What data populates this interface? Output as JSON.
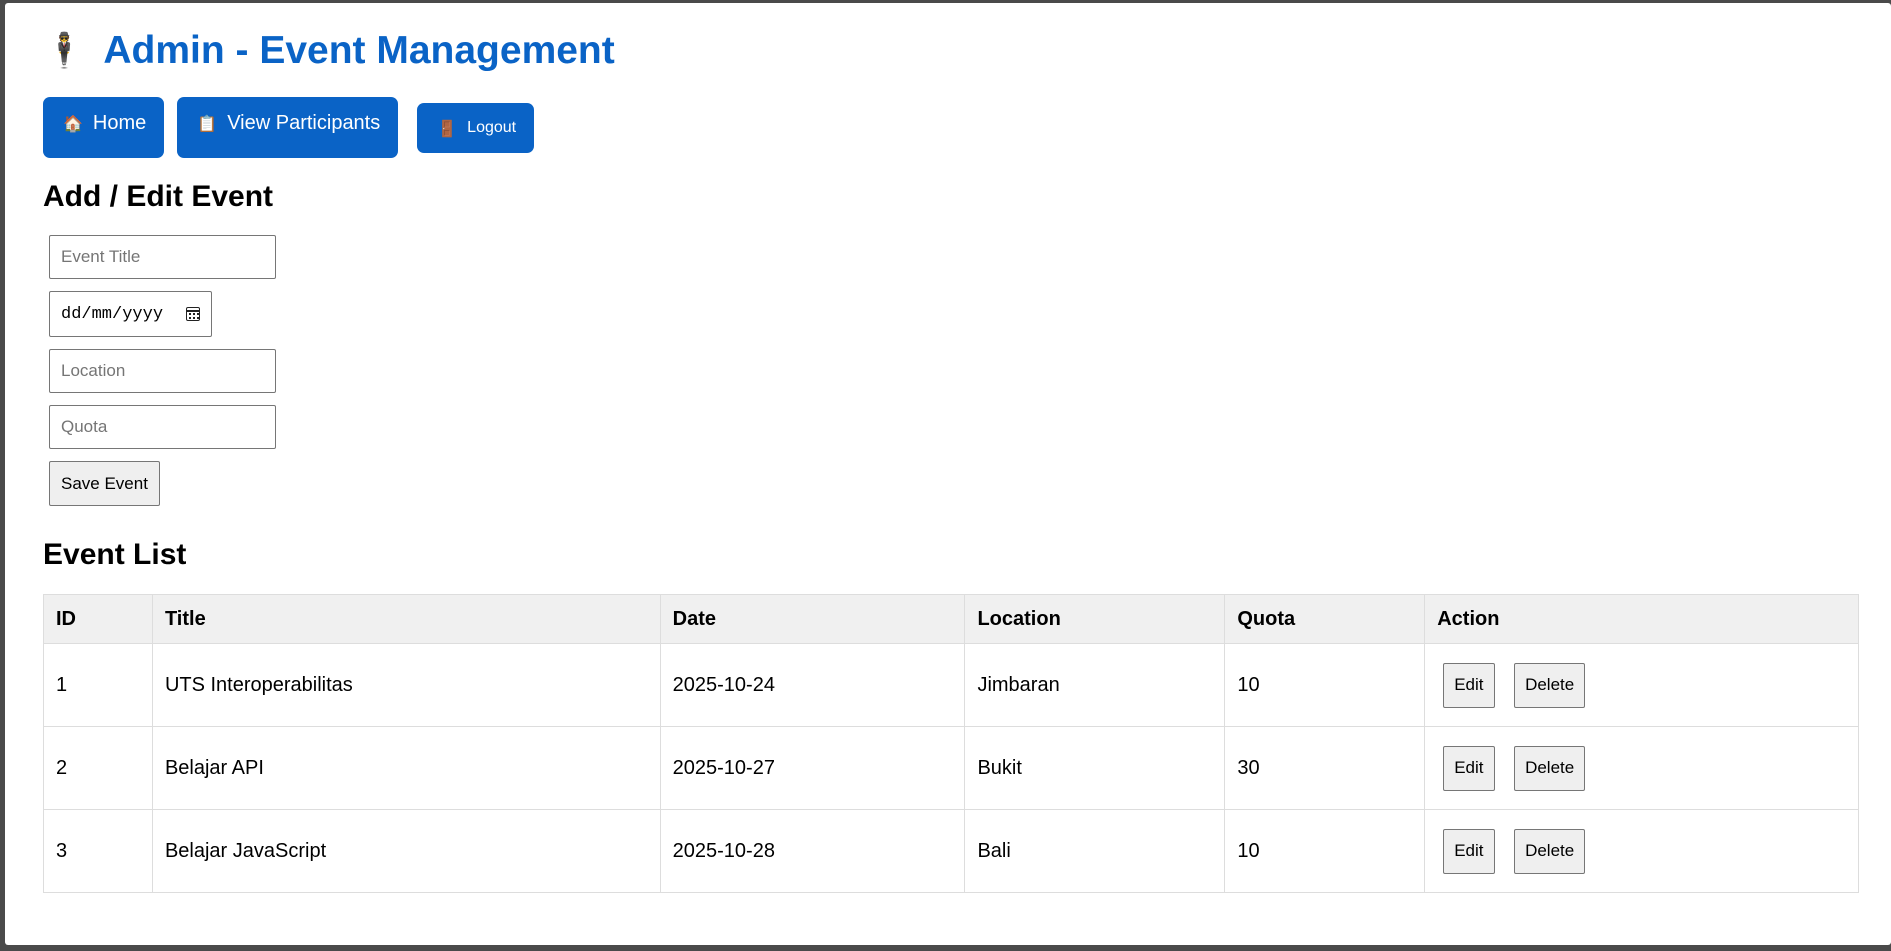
{
  "header": {
    "icon": "person-in-suit-emoji",
    "icon_glyph": "🕴",
    "title": "Admin - Event Management"
  },
  "nav": {
    "home": {
      "icon": "house-icon",
      "glyph": "🏠",
      "label": "Home"
    },
    "participants": {
      "icon": "clipboard-icon",
      "glyph": "📋",
      "label": "View Participants"
    },
    "logout": {
      "icon": "door-icon",
      "glyph": "🚪",
      "label": "Logout"
    }
  },
  "form": {
    "heading": "Add / Edit Event",
    "title_placeholder": "Event Title",
    "date_placeholder": "dd/mm/yyyy",
    "location_placeholder": "Location",
    "quota_placeholder": "Quota",
    "save_label": "Save Event"
  },
  "list": {
    "heading": "Event List",
    "columns": [
      "ID",
      "Title",
      "Date",
      "Location",
      "Quota",
      "Action"
    ],
    "rows": [
      {
        "id": "1",
        "title": "UTS Interoperabilitas",
        "date": "2025-10-24",
        "location": "Jimbaran",
        "quota": "10"
      },
      {
        "id": "2",
        "title": "Belajar API",
        "date": "2025-10-27",
        "location": "Bukit",
        "quota": "30"
      },
      {
        "id": "3",
        "title": "Belajar JavaScript",
        "date": "2025-10-28",
        "location": "Bali",
        "quota": "10"
      }
    ],
    "edit_label": "Edit",
    "delete_label": "Delete"
  },
  "colors": {
    "accent": "#0a63c6",
    "header_bg": "#f0f0f0"
  }
}
